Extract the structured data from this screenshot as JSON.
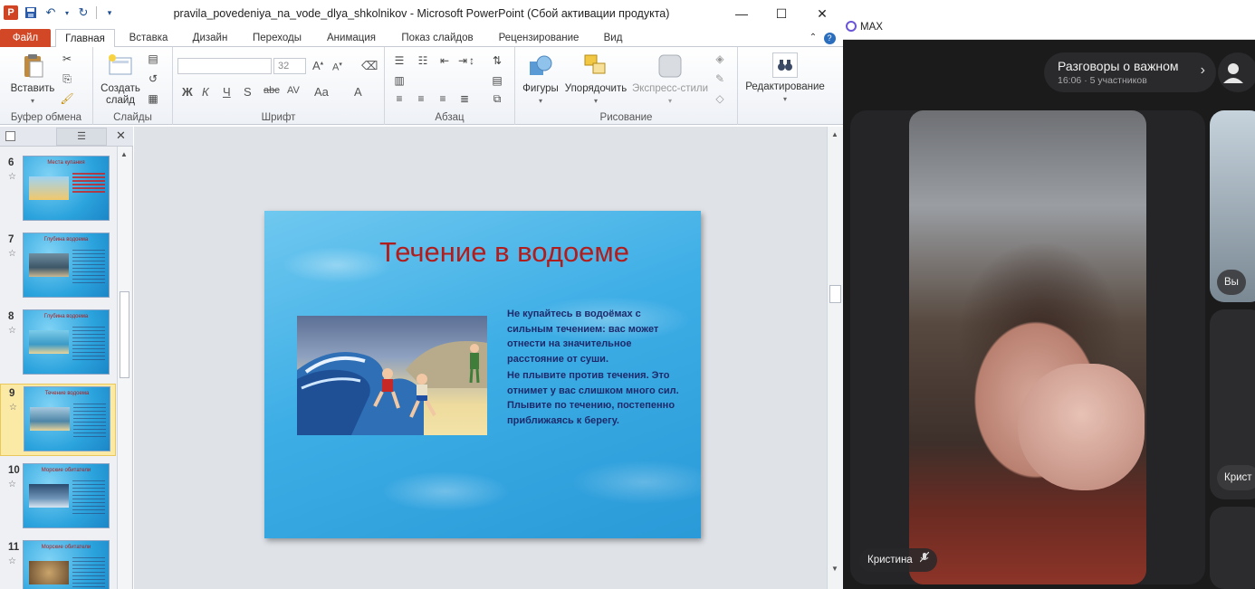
{
  "ppt": {
    "window_title": "pravila_povedeniya_na_vode_dlya_shkolnikov  -  Microsoft PowerPoint (Сбой активации продукта)",
    "tabs": [
      "Файл",
      "Главная",
      "Вставка",
      "Дизайн",
      "Переходы",
      "Анимация",
      "Показ слайдов",
      "Рецензирование",
      "Вид"
    ],
    "ribbon": {
      "paste_label": "Вставить",
      "new_slide_label_1": "Создать",
      "new_slide_label_2": "слайд",
      "font_size": "32",
      "shapes_label": "Фигуры",
      "arrange_label": "Упорядочить",
      "quick_styles_label": "Экспресс-стили",
      "editing_label": "Редактирование",
      "groups": {
        "clipboard": "Буфер обмена",
        "slides": "Слайды",
        "font": "Шрифт",
        "paragraph": "Абзац",
        "drawing": "Рисование"
      }
    },
    "thumbnails": [
      {
        "num": "6",
        "title": "Места купания"
      },
      {
        "num": "7",
        "title": "Глубина водоема"
      },
      {
        "num": "8",
        "title": "Глубина водоема"
      },
      {
        "num": "9",
        "title": "Течение водоема"
      },
      {
        "num": "10",
        "title": "Морские обитатели"
      },
      {
        "num": "11",
        "title": "Морские обитатели"
      }
    ],
    "selected_slide": "9",
    "slide": {
      "title": "Течение в водоеме",
      "para1": "Не купайтесь  в водоёмах с сильным  течением: вас может отнести на значительное расстояние  от суши.",
      "para2": "Не плывите  против течения. Это отнимет  у вас слишком много сил. Плывите  по течению, постепенно приближаясь  к берегу."
    }
  },
  "max": {
    "app_name": "MAX",
    "call_title": "Разговоры о важном",
    "call_subtitle": "16:06  ·  5 участников",
    "main_participant": "Кристина",
    "side_label_you": "Вы",
    "side_label_kristina": "Крист"
  }
}
